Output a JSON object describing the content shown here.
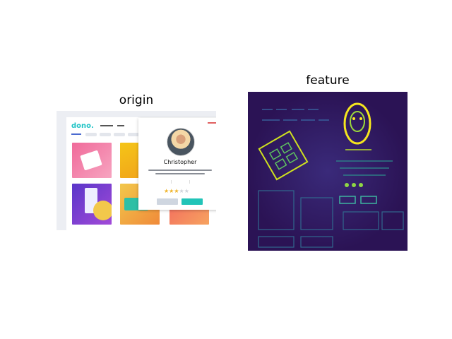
{
  "panels": {
    "origin_title": "origin",
    "feature_title": "feature"
  },
  "origin_image": {
    "logo": "dono.",
    "profile": {
      "name": "Christopher",
      "rating_stars": 3,
      "rating_max": 5
    },
    "colors": {
      "brand": "#22c4c6",
      "star": "#f0b429",
      "follow_button": "#22c4b8"
    }
  },
  "feature_image": {
    "colormap": "viridis"
  }
}
